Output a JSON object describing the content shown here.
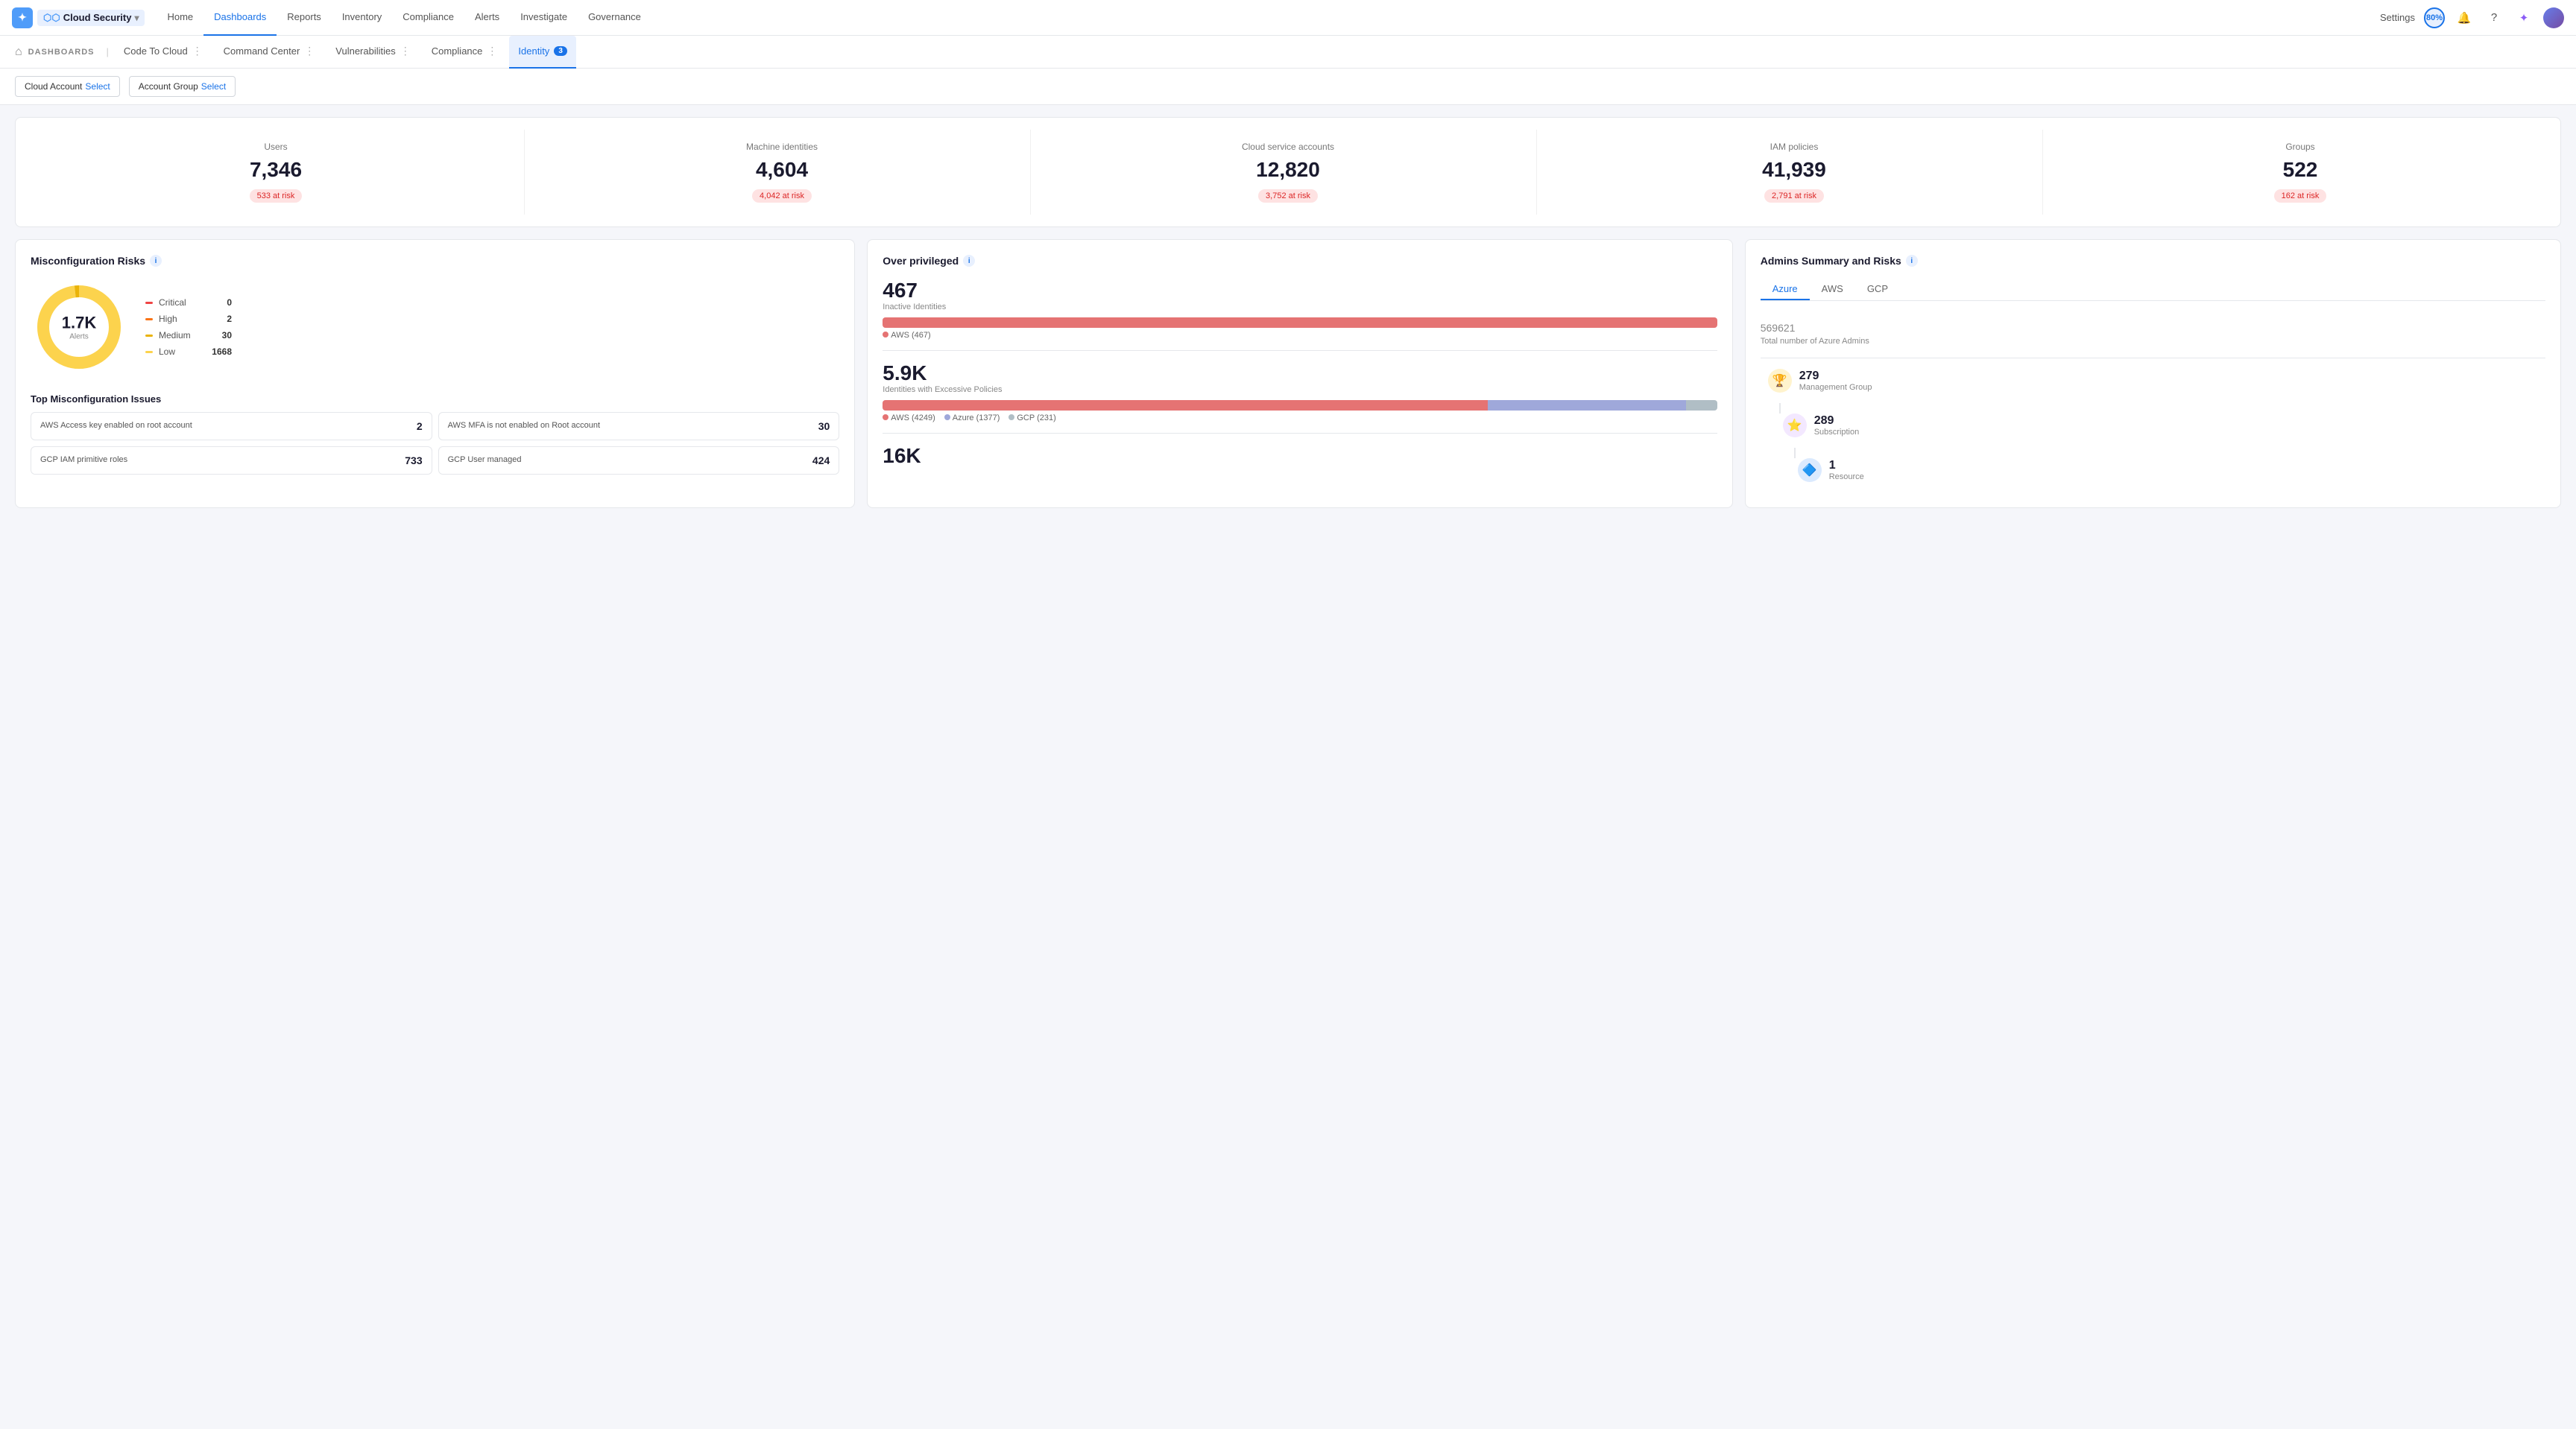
{
  "app": {
    "logo_text": "Cloud Security",
    "logo_icon": "☁"
  },
  "topnav": {
    "links": [
      {
        "label": "Home",
        "active": false
      },
      {
        "label": "Dashboards",
        "active": true
      },
      {
        "label": "Reports",
        "active": false
      },
      {
        "label": "Inventory",
        "active": false
      },
      {
        "label": "Compliance",
        "active": false
      },
      {
        "label": "Alerts",
        "active": false
      },
      {
        "label": "Investigate",
        "active": false
      },
      {
        "label": "Governance",
        "active": false
      }
    ],
    "settings_label": "Settings",
    "percentage": "80%"
  },
  "dashboard_nav": {
    "home_icon": "⌂",
    "label": "DASHBOARDS",
    "tabs": [
      {
        "label": "Code To Cloud",
        "active": false,
        "badge": null
      },
      {
        "label": "Command Center",
        "active": false,
        "badge": null
      },
      {
        "label": "Vulnerabilities",
        "active": false,
        "badge": null
      },
      {
        "label": "Compliance",
        "active": false,
        "badge": null
      },
      {
        "label": "Identity",
        "active": true,
        "badge": "3"
      }
    ]
  },
  "filters": {
    "cloud_account_label": "Cloud Account",
    "cloud_account_select": "Select",
    "account_group_label": "Account Group",
    "account_group_select": "Select"
  },
  "stat_cards": [
    {
      "label": "Users",
      "value": "7,346",
      "risk": "533 at risk"
    },
    {
      "label": "Machine identities",
      "value": "4,604",
      "risk": "4,042 at risk"
    },
    {
      "label": "Cloud service accounts",
      "value": "12,820",
      "risk": "3,752 at risk"
    },
    {
      "label": "IAM policies",
      "value": "41,939",
      "risk": "2,791 at risk"
    },
    {
      "label": "Groups",
      "value": "522",
      "risk": "162 at risk"
    }
  ],
  "misconfig": {
    "title": "Misconfiguration Risks",
    "donut": {
      "value": "1.7K",
      "label": "Alerts",
      "segments": [
        {
          "name": "Critical",
          "value": 0,
          "color": "#ef4444"
        },
        {
          "name": "High",
          "value": 2,
          "color": "#f97316"
        },
        {
          "name": "Medium",
          "value": 30,
          "color": "#eab308"
        },
        {
          "name": "Low",
          "value": 1668,
          "color": "#fcd34d"
        }
      ]
    },
    "top_issues_title": "Top Misconfiguration Issues",
    "issues": [
      {
        "text": "AWS Access key enabled on root account",
        "count": "2"
      },
      {
        "text": "AWS MFA is not enabled on Root account",
        "count": "30"
      },
      {
        "text": "GCP IAM primitive roles",
        "count": "733"
      },
      {
        "text": "GCP User managed",
        "count": "424"
      }
    ]
  },
  "over_privileged": {
    "title": "Over privileged",
    "inactive": {
      "value": "467",
      "label": "Inactive Identities",
      "bars": [
        {
          "label": "AWS (467)",
          "color": "#e57373",
          "width": 100
        }
      ]
    },
    "excessive": {
      "value": "5.9K",
      "label": "Identities with Excessive Policies",
      "bars": [
        {
          "label": "AWS (4249)",
          "color": "#e57373",
          "width": 58
        },
        {
          "label": "Azure (1377)",
          "color": "#9fa8da",
          "width": 19
        },
        {
          "label": "GCP (231)",
          "color": "#b0bec5",
          "width": 3
        }
      ]
    },
    "bottom_value": "16K"
  },
  "admins_summary": {
    "title": "Admins Summary and Risks",
    "tabs": [
      "Azure",
      "AWS",
      "GCP"
    ],
    "active_tab": "Azure",
    "azure": {
      "value": "569",
      "total": "621",
      "desc": "Total number of Azure Admins",
      "items": [
        {
          "icon": "🏆",
          "icon_type": "orange",
          "value": "279",
          "label": "Management Group"
        },
        {
          "icon": "⭐",
          "icon_type": "purple",
          "value": "289",
          "label": "Subscription"
        },
        {
          "icon": "🔷",
          "icon_type": "blue",
          "value": "1",
          "label": "Resource"
        }
      ]
    }
  }
}
